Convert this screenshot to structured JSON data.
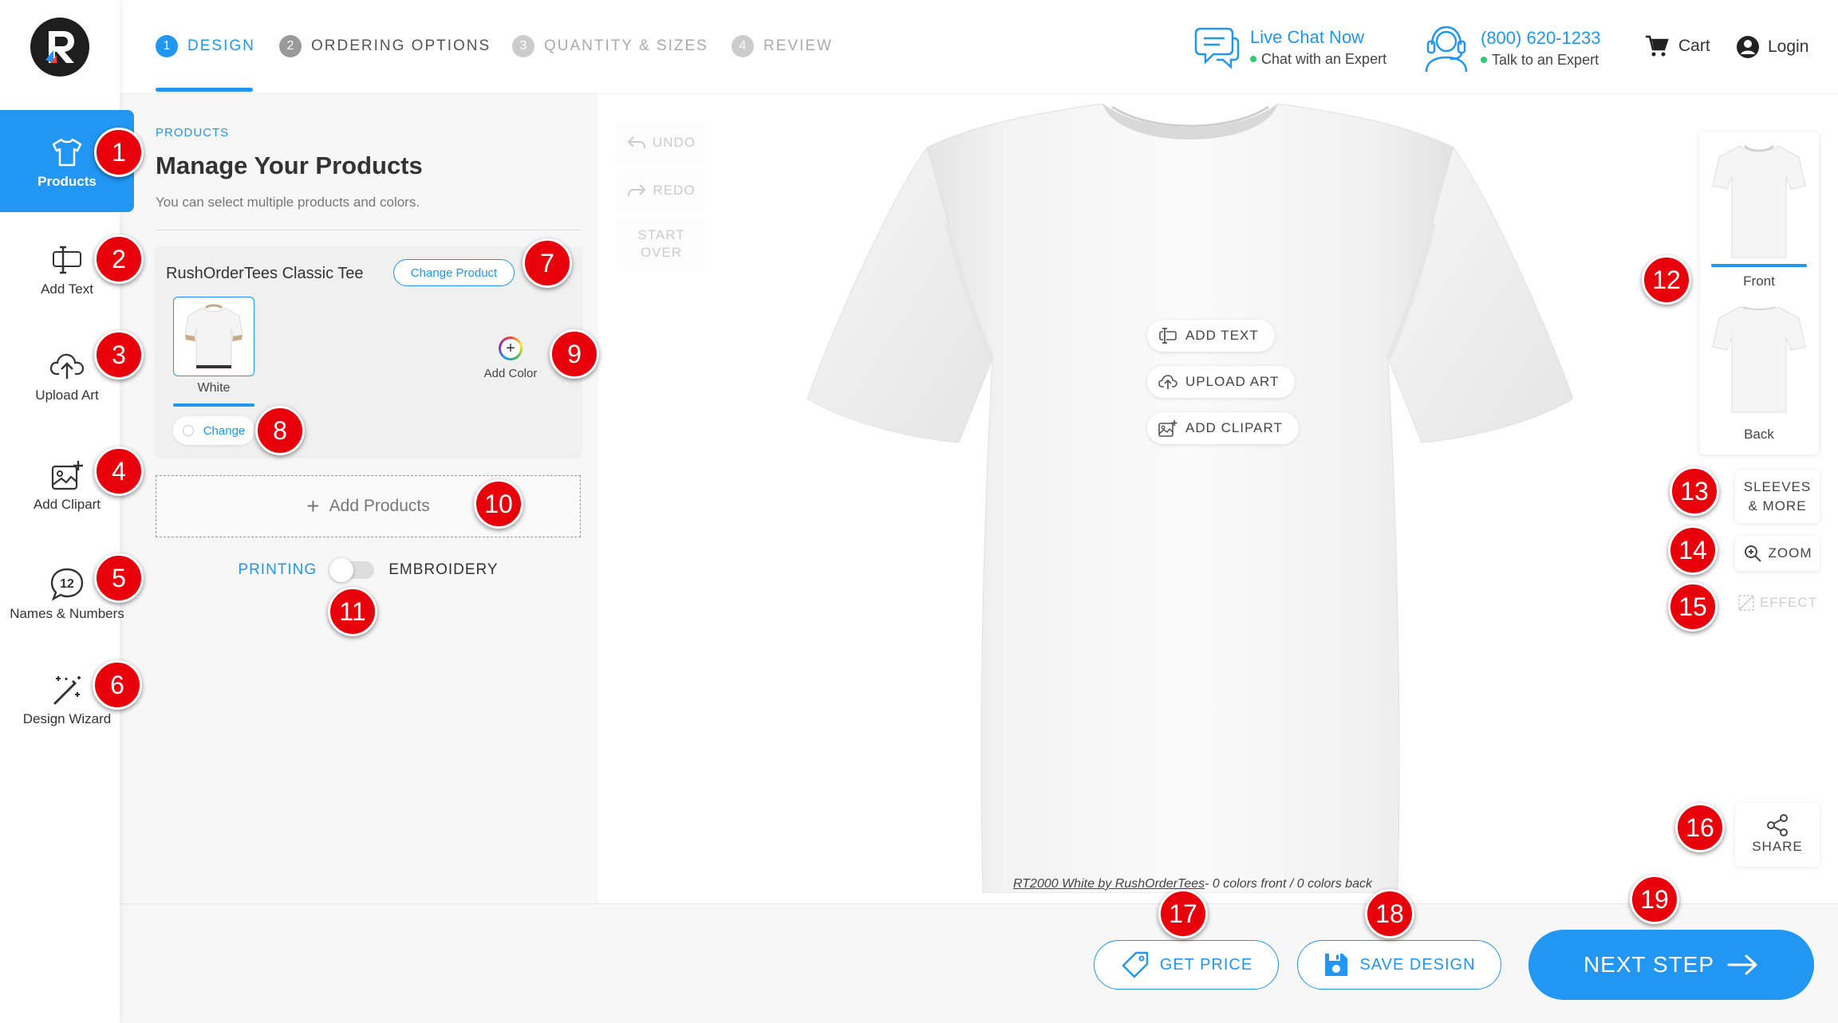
{
  "sidebar": {
    "items": [
      {
        "label": "Products",
        "icon": "tshirt-icon"
      },
      {
        "label": "Add Text",
        "icon": "text-cursor-icon"
      },
      {
        "label": "Upload Art",
        "icon": "cloud-upload-icon"
      },
      {
        "label": "Add Clipart",
        "icon": "image-plus-icon"
      },
      {
        "label": "Names & Numbers",
        "icon": "number-badge-icon"
      },
      {
        "label": "Design Wizard",
        "icon": "magic-wand-icon"
      }
    ],
    "names_badge": "12"
  },
  "steps": [
    {
      "num": "1",
      "label": "DESIGN",
      "state": "active"
    },
    {
      "num": "2",
      "label": "ORDERING OPTIONS",
      "state": "enabled"
    },
    {
      "num": "3",
      "label": "QUANTITY & SIZES",
      "state": "disabled"
    },
    {
      "num": "4",
      "label": "REVIEW",
      "state": "disabled"
    }
  ],
  "header": {
    "chat_title": "Live Chat Now",
    "chat_sub": "Chat with an Expert",
    "phone_title": "(800) 620-1233",
    "phone_sub": "Talk to an Expert",
    "cart": "Cart",
    "login": "Login"
  },
  "panel": {
    "breadcrumb": "PRODUCTS",
    "title": "Manage Your Products",
    "subtitle": "You can select multiple products and colors.",
    "product_name": "RushOrderTees Classic Tee",
    "change_product": "Change Product",
    "color_name": "White",
    "change": "Change",
    "add_color": "Add Color",
    "add_products": "Add Products",
    "printing": "PRINTING",
    "embroidery": "EMBROIDERY"
  },
  "canvas": {
    "undo": "UNDO",
    "redo": "REDO",
    "start_over_1": "START",
    "start_over_2": "OVER",
    "add_text": "ADD TEXT",
    "upload_art": "UPLOAD ART",
    "add_clipart": "ADD CLIPART",
    "caption_link": "RT2000 White by RushOrderTees",
    "caption_rest": "- 0 colors front   /   0 colors back",
    "front": "Front",
    "back": "Back",
    "sleeves_1": "SLEEVES",
    "sleeves_2": "& MORE",
    "zoom": "ZOOM",
    "effect": "EFFECT",
    "share": "SHARE"
  },
  "footer": {
    "get_price": "GET PRICE",
    "save_design": "SAVE DESIGN",
    "next_step": "NEXT STEP"
  },
  "markers": [
    "1",
    "2",
    "3",
    "4",
    "5",
    "6",
    "7",
    "8",
    "9",
    "10",
    "11",
    "12",
    "13",
    "14",
    "15",
    "16",
    "17",
    "18",
    "19"
  ],
  "colors": {
    "accent": "#2196f3",
    "marker": "#e8000b",
    "online": "#2ecc71"
  }
}
